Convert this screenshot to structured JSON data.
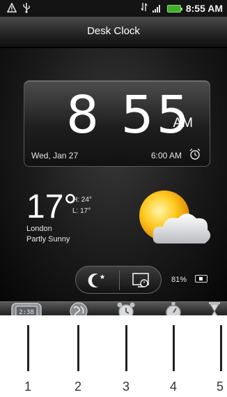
{
  "status_bar": {
    "time": "8:55 AM",
    "icons": [
      "warning-icon",
      "usb-icon",
      "network-icon",
      "signal-icon",
      "battery-icon"
    ]
  },
  "title_bar": {
    "title": "Desk Clock"
  },
  "clock": {
    "digits": "8 55",
    "ampm": "AM",
    "date": "Wed, Jan 27",
    "alarm_time": "6:00 AM"
  },
  "weather": {
    "temperature": "17°",
    "high": "H: 24°",
    "low": "L: 17°",
    "city": "London",
    "condition": "Partly Sunny"
  },
  "controls": {
    "battery_percent": "81%"
  },
  "tabs": [
    {
      "name": "clock-tab",
      "callout": "1"
    },
    {
      "name": "world-clock-tab",
      "callout": "2"
    },
    {
      "name": "alarm-tab",
      "callout": "3"
    },
    {
      "name": "stopwatch-tab",
      "callout": "4"
    },
    {
      "name": "timer-tab",
      "callout": "5"
    }
  ],
  "colors": {
    "accent_battery": "#3fae2a",
    "panel": "#1e1e1e"
  }
}
